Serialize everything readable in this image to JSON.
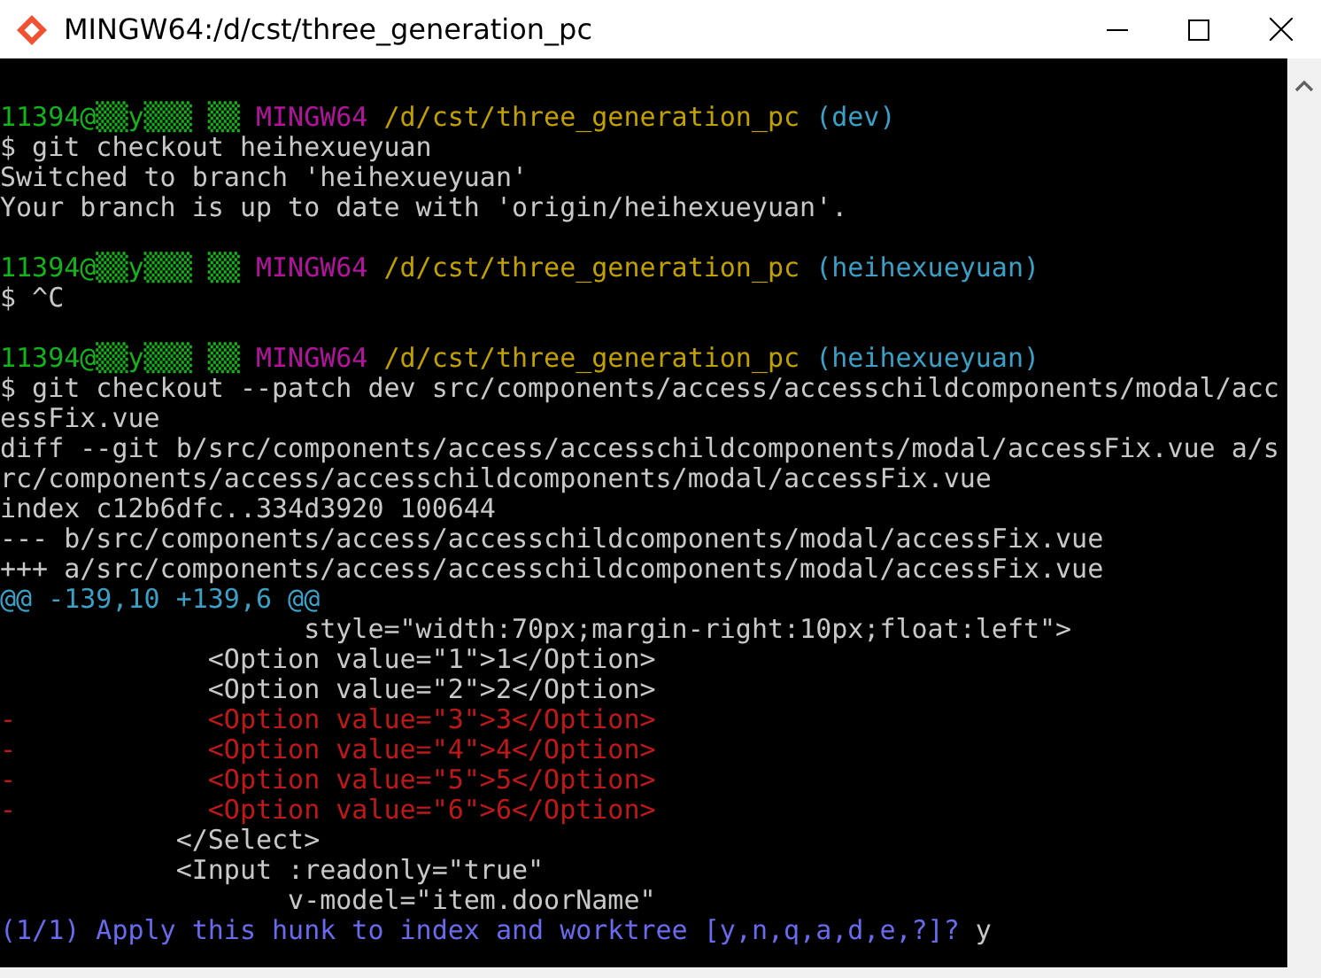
{
  "window": {
    "title": "MINGW64:/d/cst/three_generation_pc"
  },
  "terminal": {
    "lines": [
      {
        "kind": "blank"
      },
      {
        "kind": "text",
        "segments": [
          {
            "kind": "user",
            "text": "11394@▒▒y▒▒▒ ▒▒"
          },
          {
            "kind": "host",
            "text": " MINGW64"
          },
          {
            "kind": "path",
            "text": " /d/cst/three_generation_pc"
          },
          {
            "kind": "branch",
            "text": " (dev)"
          }
        ]
      },
      {
        "kind": "text",
        "segments": [
          {
            "kind": "plain",
            "text": "$ git checkout heihexueyuan"
          }
        ]
      },
      {
        "kind": "text",
        "segments": [
          {
            "kind": "plain",
            "text": "Switched to branch 'heihexueyuan'"
          }
        ]
      },
      {
        "kind": "text",
        "segments": [
          {
            "kind": "plain",
            "text": "Your branch is up to date with 'origin/heihexueyuan'."
          }
        ]
      },
      {
        "kind": "blank"
      },
      {
        "kind": "text",
        "segments": [
          {
            "kind": "user",
            "text": "11394@▒▒y▒▒▒ ▒▒"
          },
          {
            "kind": "host",
            "text": " MINGW64"
          },
          {
            "kind": "path",
            "text": " /d/cst/three_generation_pc"
          },
          {
            "kind": "branch",
            "text": " (heihexueyuan)"
          }
        ]
      },
      {
        "kind": "text",
        "segments": [
          {
            "kind": "plain",
            "text": "$ ^C"
          }
        ]
      },
      {
        "kind": "blank"
      },
      {
        "kind": "text",
        "segments": [
          {
            "kind": "user",
            "text": "11394@▒▒y▒▒▒ ▒▒"
          },
          {
            "kind": "host",
            "text": " MINGW64"
          },
          {
            "kind": "path",
            "text": " /d/cst/three_generation_pc"
          },
          {
            "kind": "branch",
            "text": " (heihexueyuan)"
          }
        ]
      },
      {
        "kind": "text",
        "segments": [
          {
            "kind": "plain",
            "text": "$ git checkout --patch dev src/components/access/accesschildcomponents/modal/acc"
          }
        ]
      },
      {
        "kind": "text",
        "segments": [
          {
            "kind": "plain",
            "text": "essFix.vue"
          }
        ]
      },
      {
        "kind": "text",
        "segments": [
          {
            "kind": "plain",
            "text": "diff --git b/src/components/access/accesschildcomponents/modal/accessFix.vue a/s"
          }
        ]
      },
      {
        "kind": "text",
        "segments": [
          {
            "kind": "plain",
            "text": "rc/components/access/accesschildcomponents/modal/accessFix.vue"
          }
        ]
      },
      {
        "kind": "text",
        "segments": [
          {
            "kind": "plain",
            "text": "index c12b6dfc..334d3920 100644"
          }
        ]
      },
      {
        "kind": "text",
        "segments": [
          {
            "kind": "plain",
            "text": "--- b/src/components/access/accesschildcomponents/modal/accessFix.vue"
          }
        ]
      },
      {
        "kind": "text",
        "segments": [
          {
            "kind": "plain",
            "text": "+++ a/src/components/access/accesschildcomponents/modal/accessFix.vue"
          }
        ]
      },
      {
        "kind": "text",
        "segments": [
          {
            "kind": "hunk",
            "text": "@@ -139,10 +139,6 @@"
          }
        ]
      },
      {
        "kind": "text",
        "segments": [
          {
            "kind": "plain",
            "text": "                   style=\"width:70px;margin-right:10px;float:left\">"
          }
        ]
      },
      {
        "kind": "text",
        "segments": [
          {
            "kind": "plain",
            "text": "             <Option value=\"1\">1</Option>"
          }
        ]
      },
      {
        "kind": "text",
        "segments": [
          {
            "kind": "plain",
            "text": "             <Option value=\"2\">2</Option>"
          }
        ]
      },
      {
        "kind": "text",
        "segments": [
          {
            "kind": "removed",
            "text": "-            <Option value=\"3\">3</Option>"
          }
        ]
      },
      {
        "kind": "text",
        "segments": [
          {
            "kind": "removed",
            "text": "-            <Option value=\"4\">4</Option>"
          }
        ]
      },
      {
        "kind": "text",
        "segments": [
          {
            "kind": "removed",
            "text": "-            <Option value=\"5\">5</Option>"
          }
        ]
      },
      {
        "kind": "text",
        "segments": [
          {
            "kind": "removed",
            "text": "-            <Option value=\"6\">6</Option>"
          }
        ]
      },
      {
        "kind": "text",
        "segments": [
          {
            "kind": "plain",
            "text": "           </Select>"
          }
        ]
      },
      {
        "kind": "text",
        "segments": [
          {
            "kind": "plain",
            "text": "           <Input :readonly=\"true\""
          }
        ]
      },
      {
        "kind": "text",
        "segments": [
          {
            "kind": "plain",
            "text": "                  v-model=\"item.doorName\""
          }
        ]
      },
      {
        "kind": "text",
        "segments": [
          {
            "kind": "prompt",
            "text": "(1/1) Apply this hunk to index and worktree [y,n,q,a,d,e,?]?"
          },
          {
            "kind": "plain",
            "text": " y"
          }
        ]
      }
    ]
  }
}
